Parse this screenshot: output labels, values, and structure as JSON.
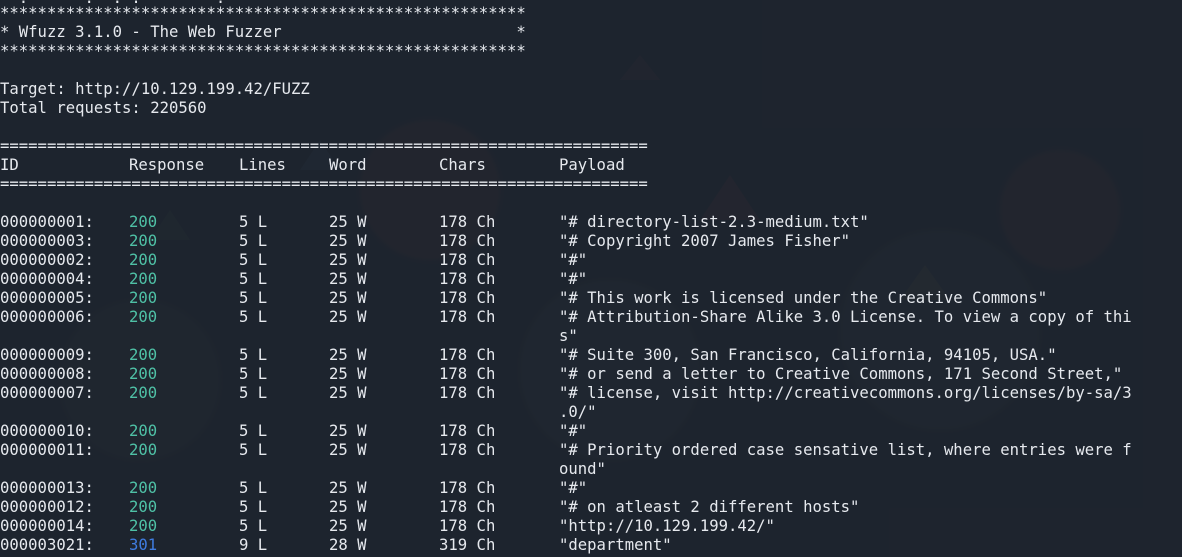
{
  "banner": {
    "line_top_partial": "  .      .  . .        .",
    "stars": "********************************************************",
    "title": "* Wfuzz 3.1.0 - The Web Fuzzer                         *"
  },
  "target_line": "Target: http://10.129.199.42/FUZZ",
  "total_line": "Total requests: 220560",
  "separator": "=====================================================================",
  "headers": {
    "id": "ID",
    "response": "Response",
    "lines": "Lines",
    "word": "Word",
    "chars": "Chars",
    "payload": "Payload"
  },
  "rows": [
    {
      "id": "000000001:",
      "code": "200",
      "lines": "5 L",
      "word": "25 W",
      "chars": "178 Ch",
      "payload": "\"# directory-list-2.3-medium.txt\"",
      "cont": ""
    },
    {
      "id": "000000003:",
      "code": "200",
      "lines": "5 L",
      "word": "25 W",
      "chars": "178 Ch",
      "payload": "\"# Copyright 2007 James Fisher\"",
      "cont": ""
    },
    {
      "id": "000000002:",
      "code": "200",
      "lines": "5 L",
      "word": "25 W",
      "chars": "178 Ch",
      "payload": "\"#\"",
      "cont": ""
    },
    {
      "id": "000000004:",
      "code": "200",
      "lines": "5 L",
      "word": "25 W",
      "chars": "178 Ch",
      "payload": "\"#\"",
      "cont": ""
    },
    {
      "id": "000000005:",
      "code": "200",
      "lines": "5 L",
      "word": "25 W",
      "chars": "178 Ch",
      "payload": "\"# This work is licensed under the Creative Commons\"",
      "cont": ""
    },
    {
      "id": "000000006:",
      "code": "200",
      "lines": "5 L",
      "word": "25 W",
      "chars": "178 Ch",
      "payload": "\"# Attribution-Share Alike 3.0 License. To view a copy of thi",
      "cont": "s\""
    },
    {
      "id": "000000009:",
      "code": "200",
      "lines": "5 L",
      "word": "25 W",
      "chars": "178 Ch",
      "payload": "\"# Suite 300, San Francisco, California, 94105, USA.\"",
      "cont": ""
    },
    {
      "id": "000000008:",
      "code": "200",
      "lines": "5 L",
      "word": "25 W",
      "chars": "178 Ch",
      "payload": "\"# or send a letter to Creative Commons, 171 Second Street,\"",
      "cont": ""
    },
    {
      "id": "000000007:",
      "code": "200",
      "lines": "5 L",
      "word": "25 W",
      "chars": "178 Ch",
      "payload": "\"# license, visit http://creativecommons.org/licenses/by-sa/3",
      "cont": ".0/\""
    },
    {
      "id": "000000010:",
      "code": "200",
      "lines": "5 L",
      "word": "25 W",
      "chars": "178 Ch",
      "payload": "\"#\"",
      "cont": ""
    },
    {
      "id": "000000011:",
      "code": "200",
      "lines": "5 L",
      "word": "25 W",
      "chars": "178 Ch",
      "payload": "\"# Priority ordered case sensative list, where entries were f",
      "cont": "ound\""
    },
    {
      "id": "000000013:",
      "code": "200",
      "lines": "5 L",
      "word": "25 W",
      "chars": "178 Ch",
      "payload": "\"#\"",
      "cont": ""
    },
    {
      "id": "000000012:",
      "code": "200",
      "lines": "5 L",
      "word": "25 W",
      "chars": "178 Ch",
      "payload": "\"# on atleast 2 different hosts\"",
      "cont": ""
    },
    {
      "id": "000000014:",
      "code": "200",
      "lines": "5 L",
      "word": "25 W",
      "chars": "178 Ch",
      "payload": "\"http://10.129.199.42/\"",
      "cont": ""
    },
    {
      "id": "000003021:",
      "code": "301",
      "lines": "9 L",
      "word": "28 W",
      "chars": "319 Ch",
      "payload": "\"department\"",
      "cont": ""
    }
  ],
  "colors": {
    "background": "#1f2631",
    "text": "#e6e9ee",
    "code_200": "#4fc1a6",
    "code_301": "#3f7ce0"
  }
}
